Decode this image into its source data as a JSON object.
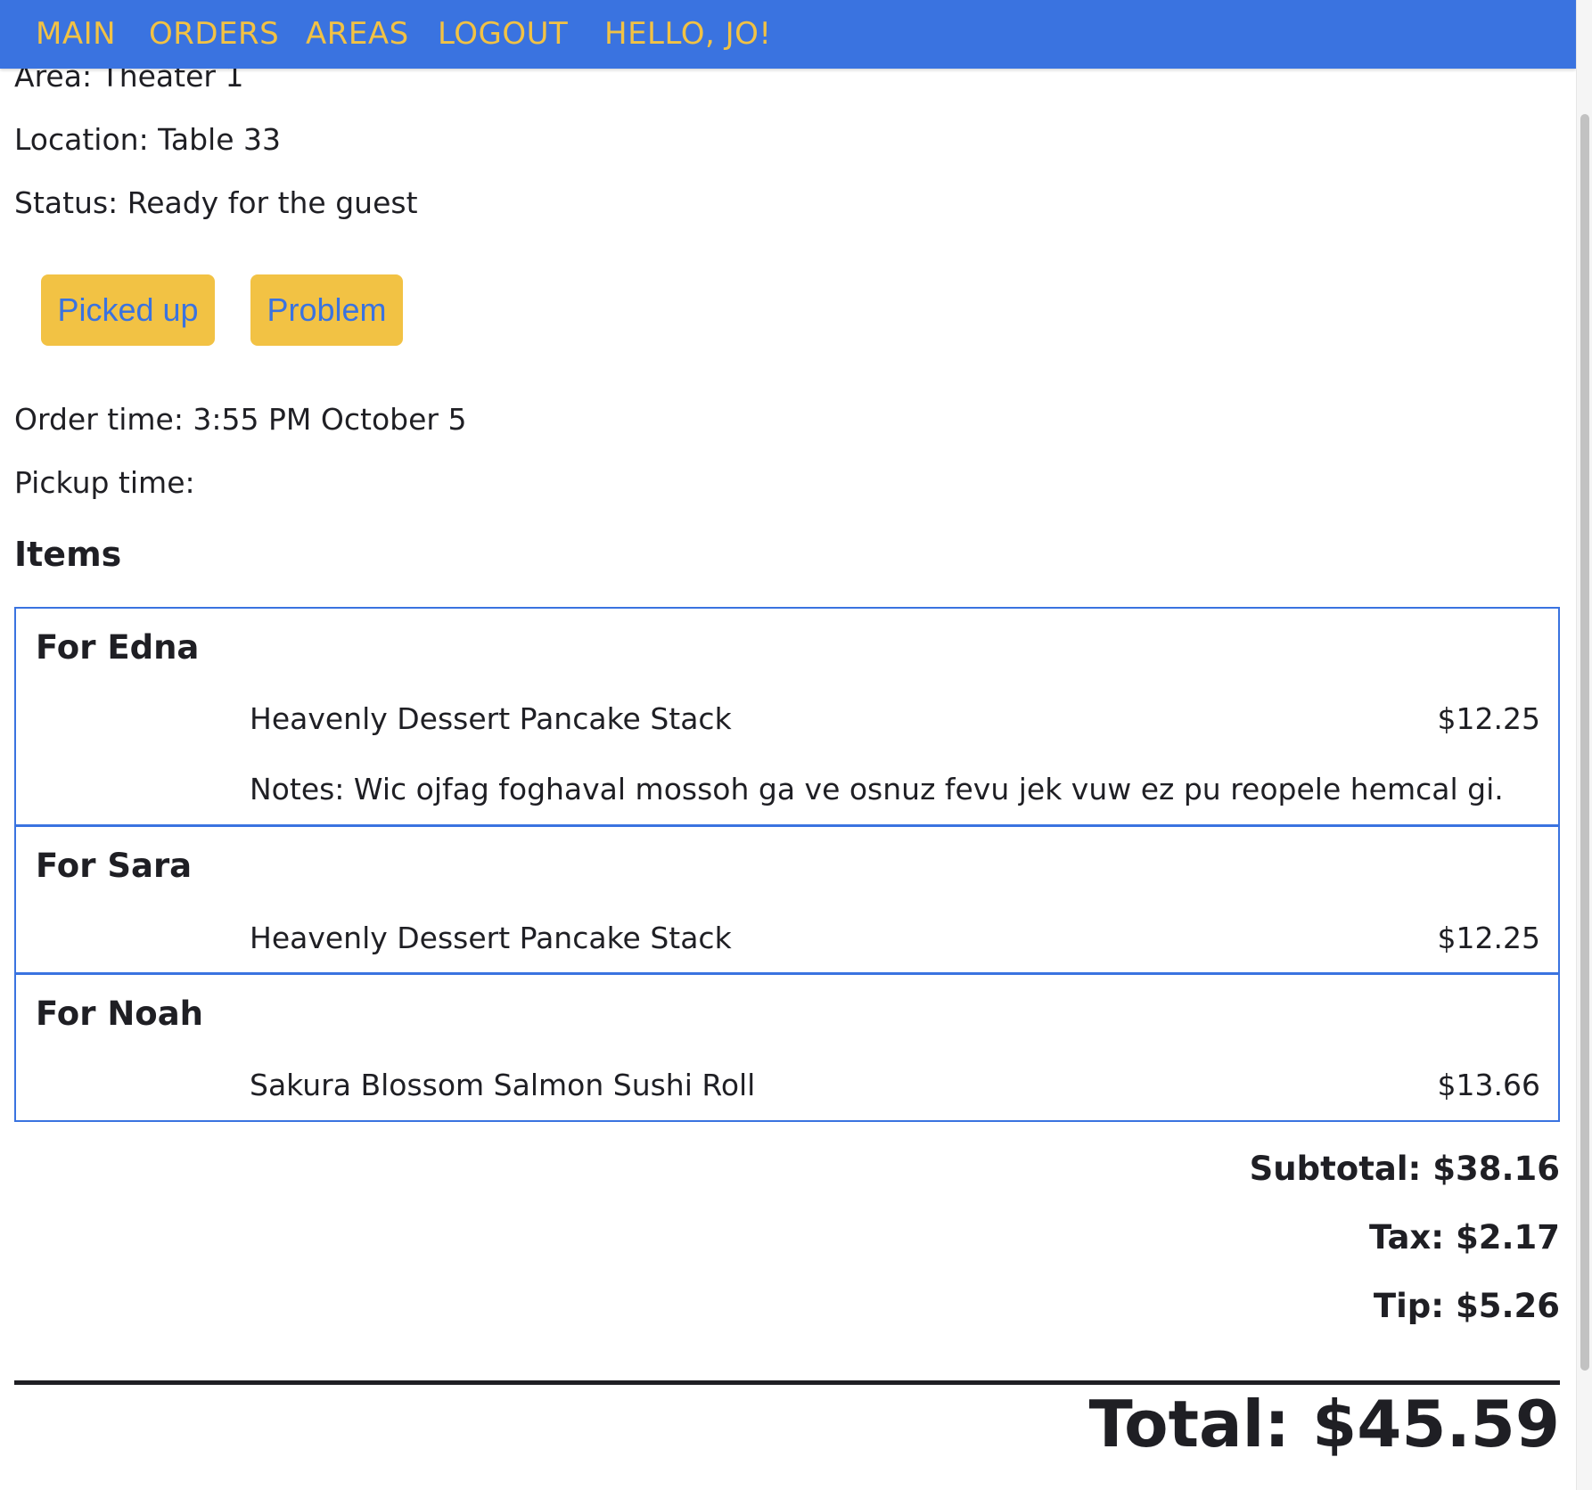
{
  "nav": {
    "items": [
      {
        "label": "MAIN"
      },
      {
        "label": "ORDERS"
      },
      {
        "label": "AREAS"
      },
      {
        "label": "LOGOUT"
      }
    ],
    "greeting": "HELLO, JO!"
  },
  "order": {
    "area": "Area: Theater 1",
    "location": "Location: Table 33",
    "status": "Status: Ready for the guest",
    "order_time": "Order time: 3:55 PM October 5",
    "pickup_time": "Pickup time:"
  },
  "actions": {
    "picked_up_label": "Picked up",
    "problem_label": "Problem"
  },
  "items_heading": "Items",
  "groups": [
    {
      "title": "For Edna",
      "items": [
        {
          "name": "Heavenly Dessert Pancake Stack",
          "price": "$12.25",
          "notes": "Notes: Wic ojfag foghaval mossoh ga ve osnuz fevu jek vuw ez pu reopele hemcal gi."
        }
      ]
    },
    {
      "title": "For Sara",
      "items": [
        {
          "name": "Heavenly Dessert Pancake Stack",
          "price": "$12.25"
        }
      ]
    },
    {
      "title": "For Noah",
      "items": [
        {
          "name": "Sakura Blossom Salmon Sushi Roll",
          "price": "$13.66"
        }
      ]
    }
  ],
  "summary": {
    "subtotal": "Subtotal: $38.16",
    "tax": "Tax: $2.17",
    "tip": "Tip: $5.26",
    "total": "Total: $45.59"
  },
  "colors": {
    "nav_background": "#3a73e0",
    "nav_text": "#f2c244",
    "button_background": "#f2c244",
    "button_text": "#3a73e0",
    "group_border": "#3a73e0"
  }
}
